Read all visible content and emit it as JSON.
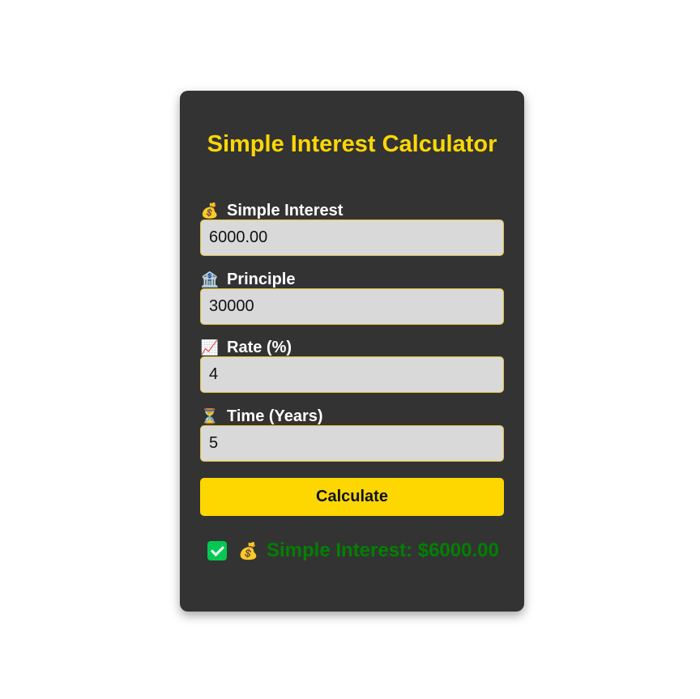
{
  "title": "Simple Interest Calculator",
  "fields": [
    {
      "icon": "💰",
      "icon_name": "money-bag-icon",
      "label": "Simple Interest",
      "value": "6000.00"
    },
    {
      "icon": "🏦",
      "icon_name": "bank-icon",
      "label": "Principle",
      "value": "30000"
    },
    {
      "icon": "📈",
      "icon_name": "chart-increasing-icon",
      "label": "Rate (%)",
      "value": "4"
    },
    {
      "icon": "⏳",
      "icon_name": "hourglass-icon",
      "label": "Time (Years)",
      "value": "5"
    }
  ],
  "button": {
    "label": "Calculate"
  },
  "result": {
    "check_icon": "check-icon",
    "icon": "💰",
    "icon_name": "money-bag-icon",
    "text": "Simple Interest: $6000.00"
  },
  "colors": {
    "accent": "#ffd700",
    "card": "#333333",
    "result": "#008000",
    "success": "#00c853"
  }
}
